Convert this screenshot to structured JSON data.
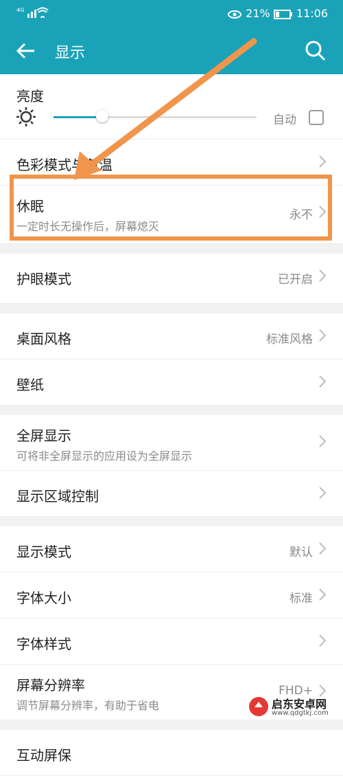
{
  "status": {
    "left": "⁴ᴳ",
    "battery": "21%",
    "time": "11:06"
  },
  "header": {
    "title": "显示"
  },
  "brightness": {
    "label": "亮度",
    "auto_label": "自动",
    "level_fraction": 0.24
  },
  "rows": {
    "color_mode": {
      "label": "色彩模式与色温"
    },
    "sleep": {
      "label": "休眠",
      "sub": "一定时长无操作后，屏幕熄灭",
      "value": "永不"
    },
    "eye_comfort": {
      "label": "护眼模式",
      "value": "已开启"
    },
    "home_style": {
      "label": "桌面风格",
      "value": "标准风格"
    },
    "wallpaper": {
      "label": "壁纸"
    },
    "fullscreen": {
      "label": "全屏显示",
      "sub": "可将非全屏显示的应用设为全屏显示"
    },
    "display_area": {
      "label": "显示区域控制"
    },
    "display_mode": {
      "label": "显示模式",
      "value": "默认"
    },
    "font_size": {
      "label": "字体大小",
      "value": "标准"
    },
    "font_style": {
      "label": "字体样式"
    },
    "resolution": {
      "label": "屏幕分辨率",
      "sub": "调节屏幕分辨率，有助于省电",
      "value": "FHD+"
    },
    "interactive_screensaver": {
      "label": "互动屏保"
    }
  },
  "watermark": {
    "text": "启东安卓网",
    "url_text": "www.qdgtkj.com"
  },
  "colors": {
    "accent": "#1aa3b8",
    "annotation": "#f0954b"
  }
}
